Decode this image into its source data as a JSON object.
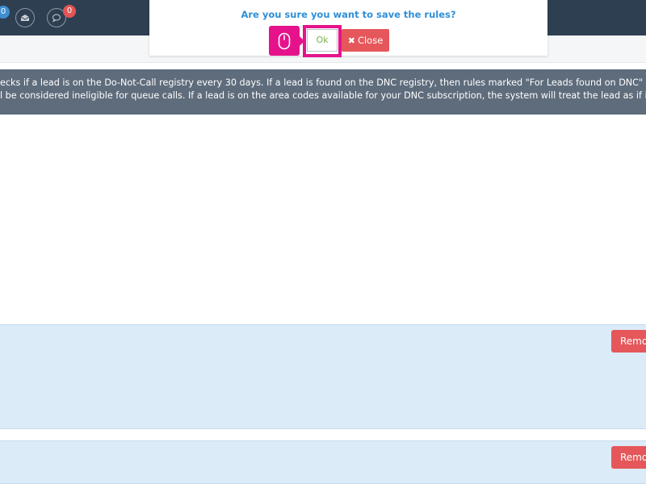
{
  "topbar": {
    "notifications_count": "0",
    "messages_count": "0",
    "icons": [
      "notifications-icon",
      "mail-icon",
      "chat-icon"
    ]
  },
  "dialog": {
    "title": "Are you sure you want to save the rules?",
    "ok_label": "Ok",
    "close_label": "Close",
    "close_icon": "close-icon"
  },
  "banner": {
    "line1": "ecks if a lead is on the Do-Not-Call registry every 30 days. If a lead is found on the DNC registry, then rules marked \"For Leads found on DNC\" will a",
    "line2": "l be considered ineligible for queue calls. If a lead is on the area codes available for your DNC subscription, the system will treat the lead as if it w"
  },
  "rules": {
    "remove_label": "Remove"
  },
  "colors": {
    "topbar": "#2f3f52",
    "dialog_title": "#2f8fd8",
    "danger": "#e5575a",
    "highlight": "#e6128c",
    "rule_bg": "#dcebf8",
    "banner_bg": "#5e6c7c"
  }
}
